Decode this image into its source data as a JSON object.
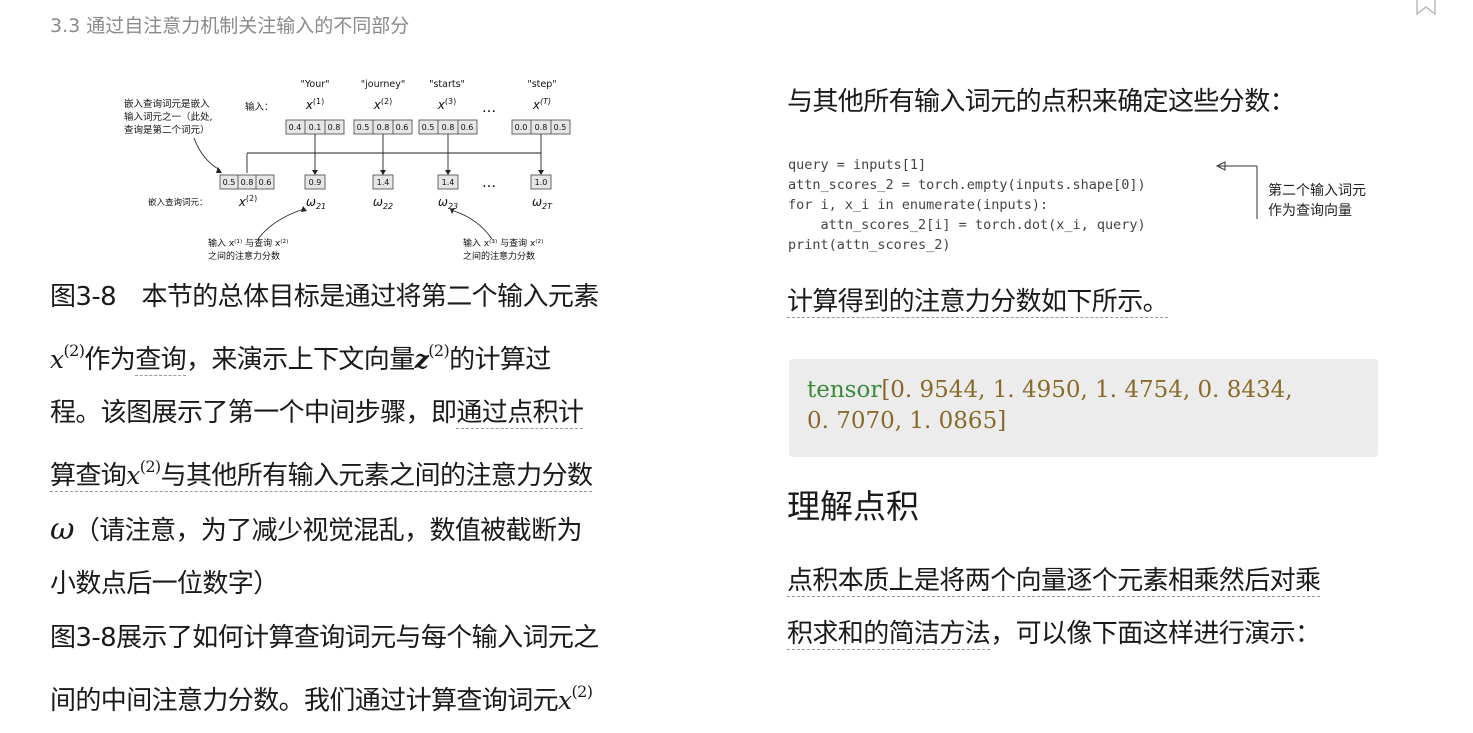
{
  "header": {
    "title": "3.3 通过自注意力机制关注输入的不同部分"
  },
  "figure": {
    "left_note": [
      "嵌入查询词元是嵌入",
      "输入词元之一（此处,",
      "查询是第二个词元）"
    ],
    "inputs_label": "输入：",
    "query_label": "嵌入查询词元：",
    "tokens": [
      "\"Your\"",
      "\"journey\"",
      "\"starts\"",
      "\"step\""
    ],
    "input_vectors": [
      [
        "0.4",
        "0.1",
        "0.8"
      ],
      [
        "0.5",
        "0.8",
        "0.6"
      ],
      [
        "0.5",
        "0.8",
        "0.6"
      ],
      [
        "0.0",
        "0.8",
        "0.5"
      ]
    ],
    "query_vector": [
      "0.5",
      "0.8",
      "0.6"
    ],
    "scores": [
      "0.9",
      "1.4",
      "1.4",
      "1.0"
    ],
    "ellipsis": "…",
    "bottom_note_left": [
      "输入 x⁽¹⁾ 与查询 x⁽²⁾",
      "之间的注意力分数"
    ],
    "bottom_note_right": [
      "输入 x⁽³⁾ 与查询 x⁽²⁾",
      "之间的注意力分数"
    ]
  },
  "caption": {
    "p1": "图3-8　本节的总体目标是通过将第二个输入元素",
    "x": "x",
    "sup2": "(2)",
    "p2": "作为",
    "p2u": "查询",
    "p3": "，来演示上下文向量",
    "z": "z",
    "p4": "的计算过",
    "p5": "程。该图展示了第一个中间步骤，即",
    "p5u": "通过点积计",
    "p6u": "算查询",
    "p7u": "与其他所有输入元素之间的注意力分数",
    "omega": "ω",
    "p8": "（请注意，为了减少视觉混乱，数值被截断为",
    "p9": "小数点后一位数字）"
  },
  "body_left": {
    "line1": "图3-8展示了如何计算查询词元与每个输入词元之",
    "line2": "间的中间注意力分数。我们通过计算查询词元"
  },
  "right": {
    "intro": "与其他所有输入词元的点积来确定这些分数：",
    "code": "query = inputs[1]\nattn_scores_2 = torch.empty(inputs.shape[0])\nfor i, x_i in enumerate(inputs):\n    attn_scores_2[i] = torch.dot(x_i, query)\nprint(attn_scores_2)",
    "code_annotation": [
      "第二个输入词元",
      "作为查询向量"
    ],
    "result_text": "计算得到的注意力分数如下所示。",
    "output_kw": "tensor",
    "output_values": "[0. 9544,   1. 4950,   1. 4754,   0. 8434,",
    "output_values2": "0. 7070,   1. 0865]",
    "heading": "理解点积",
    "dot_line1": "点积本质上是将两个向量逐个元素相乘然后对乘",
    "dot_line2a": "积求和的简洁方法",
    "dot_line2b": "，可以像下面这样进行演示："
  }
}
